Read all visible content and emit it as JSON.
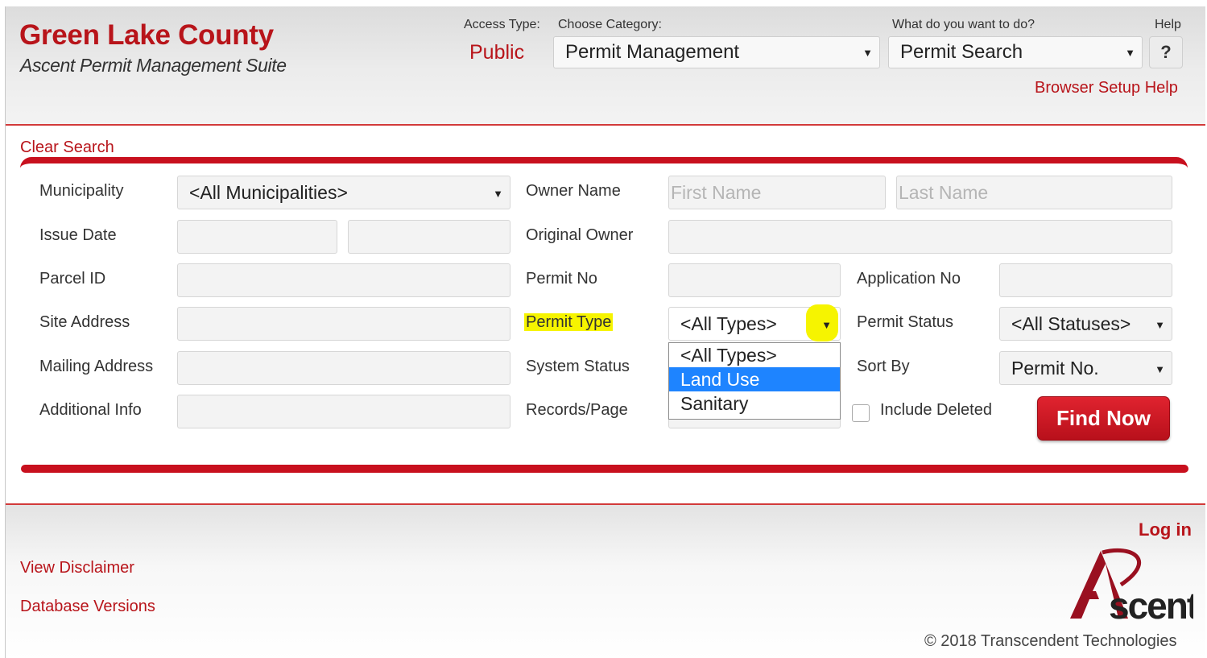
{
  "header": {
    "title": "Green Lake County",
    "subtitle": "Ascent Permit Management Suite",
    "access_type_label": "Access Type:",
    "access_type_value": "Public",
    "category_label": "Choose Category:",
    "category_value": "Permit Management",
    "action_label": "What do you want to do?",
    "action_value": "Permit Search",
    "help_label": "Help",
    "help_button": "?",
    "browser_setup_link": "Browser Setup Help"
  },
  "clear_search_link": "Clear Search",
  "form": {
    "municipality_label": "Municipality",
    "municipality_value": "<All Municipalities>",
    "owner_name_label": "Owner Name",
    "first_name_placeholder": "First Name",
    "last_name_placeholder": "Last Name",
    "issue_date_label": "Issue Date",
    "original_owner_label": "Original Owner",
    "parcel_id_label": "Parcel ID",
    "permit_no_label": "Permit No",
    "application_no_label": "Application No",
    "site_address_label": "Site Address",
    "permit_type_label": "Permit Type",
    "permit_type_value": "<All Types>",
    "permit_type_options": [
      "<All Types>",
      "Land Use",
      "Sanitary"
    ],
    "permit_type_highlighted_option": "Land Use",
    "permit_status_label": "Permit Status",
    "permit_status_value": "<All Statuses>",
    "mailing_address_label": "Mailing Address",
    "system_status_label": "System Status",
    "sort_by_label": "Sort By",
    "sort_by_value": "Permit No.",
    "additional_info_label": "Additional Info",
    "records_page_label": "Records/Page",
    "include_deleted_label": "Include Deleted",
    "include_deleted_checked": false,
    "find_now_button": "Find Now"
  },
  "footer": {
    "login_link": "Log in",
    "disclaimer_link": "View Disclaimer",
    "db_versions_link": "Database Versions",
    "logo_text": "Ascent",
    "copyright": "© 2018 Transcendent Technologies"
  },
  "colors": {
    "brand_red": "#b8141a",
    "accent_red": "#c8101e",
    "highlight_yellow": "#f6f400",
    "selected_option_blue": "#1e84ff"
  }
}
